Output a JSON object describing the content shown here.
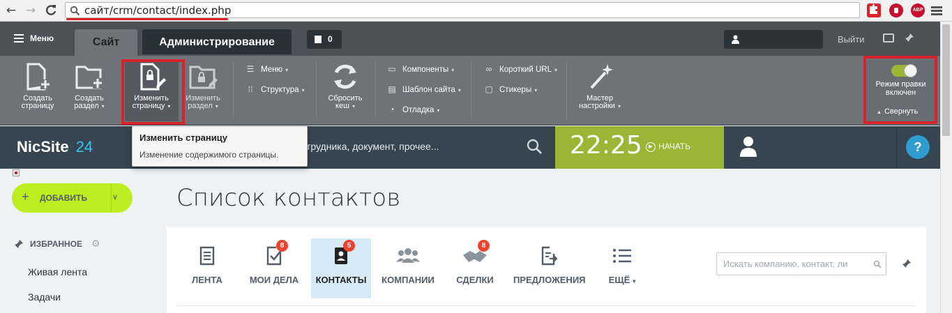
{
  "browser": {
    "back_icon": "←",
    "forward_icon": "→",
    "reload_icon": "C",
    "url": "сайт/crm/contact/index.php",
    "extensions": [
      {
        "name": "puzzle",
        "color": "#d8232a"
      },
      {
        "name": "adblock",
        "color": "#c8102e"
      },
      {
        "name": "abp",
        "label": "ABP",
        "color": "#c8102e"
      }
    ]
  },
  "panel": {
    "menu_label": "Меню",
    "tabs": [
      "Сайт",
      "Администрирование"
    ],
    "counter": "0",
    "logout": "Выйти",
    "tools": [
      {
        "l1": "Создать",
        "l2": "страницу"
      },
      {
        "l1": "Создать",
        "l2": "раздел"
      },
      {
        "l1": "Изменить",
        "l2": "страницу"
      },
      {
        "l1": "Изменить",
        "l2": "раздел"
      },
      {
        "l1": "Сбросить",
        "l2": "кеш"
      },
      {
        "l1": "Мастер",
        "l2": "настройки"
      }
    ],
    "small_col1": [
      "Меню",
      "Структура"
    ],
    "small_col2": [
      "Компоненты",
      "Шаблон сайта",
      "Отладка"
    ],
    "small_col3": [
      "Короткий URL",
      "Стикеры"
    ],
    "edit_mode_l1": "Режим правки",
    "edit_mode_l2": "включен",
    "collapse": "Свернуть"
  },
  "tooltip": {
    "title": "Изменить страницу",
    "text": "Изменение содержимого страницы."
  },
  "header": {
    "logo_main": "NicSite",
    "logo_num": "24",
    "search_placeholder": "искать сотрудника, документ, прочее...",
    "time": "22:25",
    "start": "НАЧАТЬ",
    "help": "?"
  },
  "colors": {
    "accent_green": "#9cb534",
    "add_button": "#bbed21",
    "header_bg": "#36454f",
    "highlight_red": "#d8232a",
    "badge_red": "#f0432f",
    "logo_blue": "#2fc6f6"
  },
  "sidebar": {
    "add_label": "ДОБАВИТЬ",
    "favorites_label": "ИЗБРАННОЕ",
    "items": [
      "Живая лента",
      "Задачи"
    ]
  },
  "page": {
    "title": "Список контактов"
  },
  "crm_tabs": [
    {
      "label": "ЛЕНТА",
      "icon": "doc-icon"
    },
    {
      "label": "МОИ ДЕЛА",
      "icon": "checklist-icon",
      "badge": "8"
    },
    {
      "label": "КОНТАКТЫ",
      "icon": "contacts-icon",
      "badge": "5",
      "active": true
    },
    {
      "label": "КОМПАНИИ",
      "icon": "people-icon"
    },
    {
      "label": "СДЕЛКИ",
      "icon": "handshake-icon",
      "badge": "8"
    },
    {
      "label": "ПРЕДЛОЖЕНИЯ",
      "icon": "offer-icon"
    },
    {
      "label": "ЕЩЁ",
      "icon": "list-icon"
    }
  ],
  "crm_search_placeholder": "Искать компанию, контакт, ли"
}
